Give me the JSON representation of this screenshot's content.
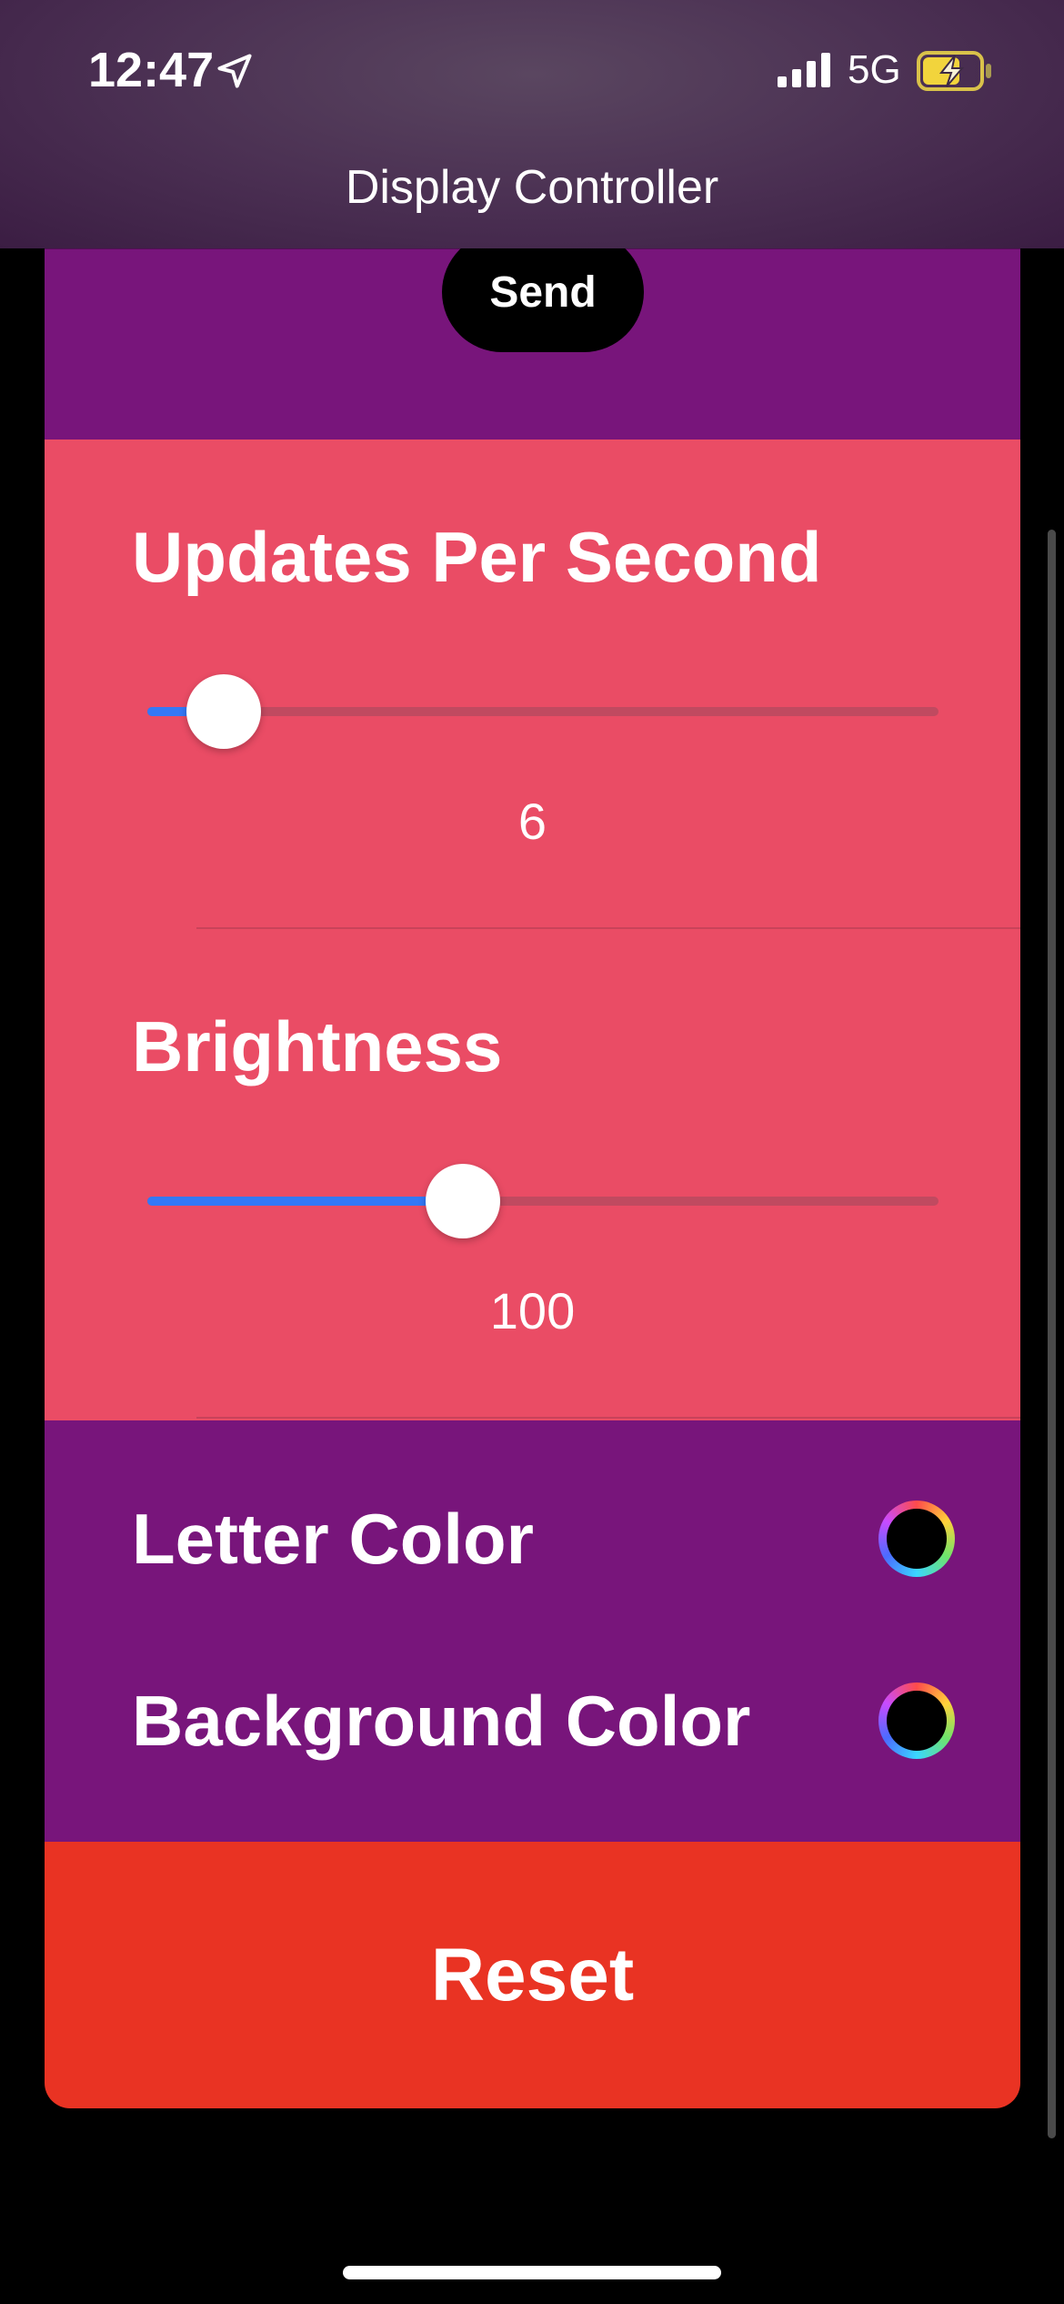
{
  "status_bar": {
    "time": "12:47",
    "network": "5G",
    "icons": [
      "location-arrow-icon",
      "cellular-signal-icon",
      "battery-charging-icon"
    ]
  },
  "nav": {
    "title": "Display Controller"
  },
  "send_button": {
    "label": "Send"
  },
  "updates": {
    "title": "Updates Per Second",
    "value": "6",
    "slider_fraction": 0.097
  },
  "brightness": {
    "title": "Brightness",
    "value": "100",
    "slider_fraction": 0.399
  },
  "colors": {
    "letter_label": "Letter Color",
    "letter_value": "#000000",
    "background_label": "Background Color",
    "background_value": "#000000"
  },
  "reset_button": {
    "label": "Reset"
  },
  "theme": {
    "purple": "#78157b",
    "pink": "#ea4c65",
    "red": "#e93323",
    "slider_accent": "#3478f6"
  }
}
